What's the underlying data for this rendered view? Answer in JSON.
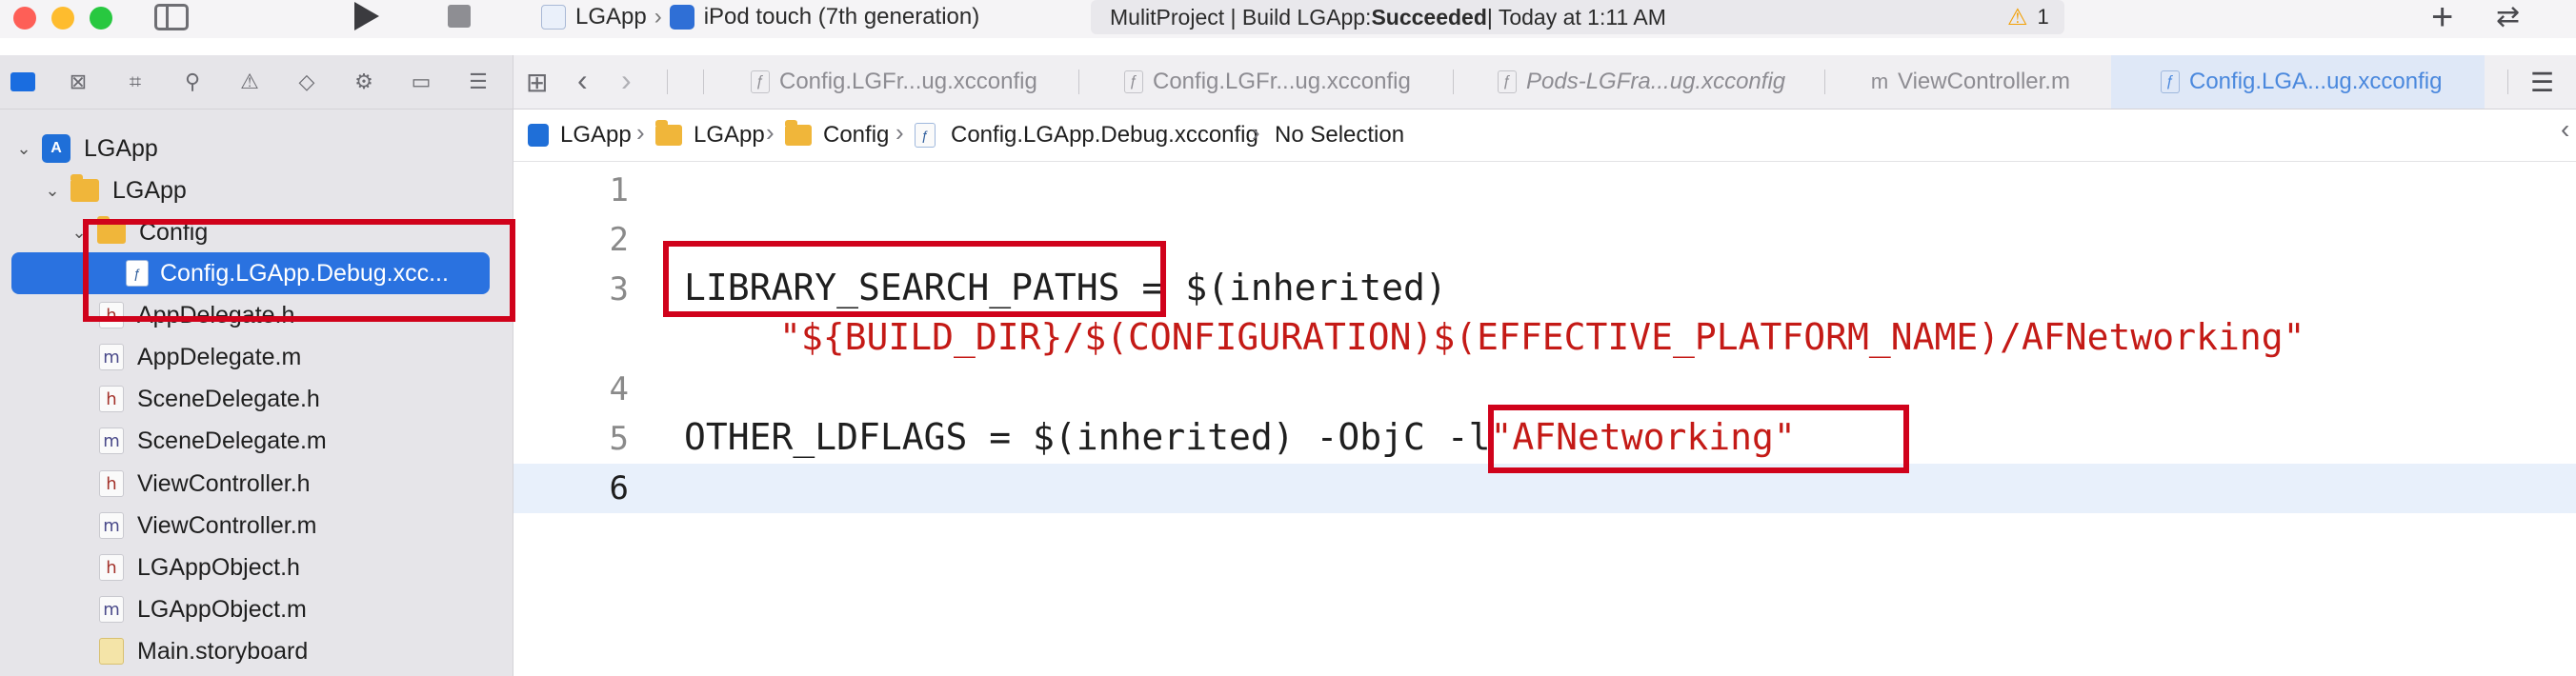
{
  "toolbar": {
    "scheme": "LGApp",
    "destination": "iPod touch (7th generation)",
    "status_project": "MulitProject | Build LGApp: ",
    "status_result": "Succeeded",
    "status_time": " | Today at 1:11 AM",
    "warning_count": "1"
  },
  "tabs": [
    {
      "label": "Config.LGFr...ug.xcconfig",
      "icon": "xcconfig-file-icon"
    },
    {
      "label": "Config.LGFr...ug.xcconfig",
      "icon": "xcconfig-file-icon"
    },
    {
      "label": "Pods-LGFra...ug.xcconfig",
      "icon": "xcconfig-file-icon"
    },
    {
      "label": "ViewController.m",
      "icon": "objc-m-file-icon"
    },
    {
      "label": "Config.LGA...ug.xcconfig",
      "icon": "xcconfig-file-icon",
      "active": true
    }
  ],
  "jumpbar": {
    "items": [
      "LGApp",
      "LGApp",
      "Config",
      "Config.LGApp.Debug.xcconfig",
      "No Selection"
    ]
  },
  "navigator": {
    "items": [
      {
        "label": "LGApp",
        "type": "project",
        "glyph": "A"
      },
      {
        "label": "LGApp",
        "type": "folder"
      },
      {
        "label": "Config",
        "type": "folder"
      },
      {
        "label": "Config.LGApp.Debug.xcc...",
        "type": "xcconfig",
        "selected": true
      },
      {
        "label": "AppDelegate.h",
        "type": "h",
        "glyph": "h"
      },
      {
        "label": "AppDelegate.m",
        "type": "m",
        "glyph": "m"
      },
      {
        "label": "SceneDelegate.h",
        "type": "h",
        "glyph": "h"
      },
      {
        "label": "SceneDelegate.m",
        "type": "m",
        "glyph": "m"
      },
      {
        "label": "ViewController.h",
        "type": "h",
        "glyph": "h"
      },
      {
        "label": "ViewController.m",
        "type": "m",
        "glyph": "m"
      },
      {
        "label": "LGAppObject.h",
        "type": "h",
        "glyph": "h"
      },
      {
        "label": "LGAppObject.m",
        "type": "m",
        "glyph": "m"
      },
      {
        "label": "Main.storyboard",
        "type": "storyboard"
      }
    ]
  },
  "editor": {
    "line_numbers": [
      "1",
      "2",
      "3",
      "4",
      "5",
      "6"
    ],
    "line3_key": "LIBRARY_SEARCH_PATHS",
    "line3_rest": " = $(inherited)",
    "line3_cont": "\"${BUILD_DIR}/$(CONFIGURATION)$(EFFECTIVE_PLATFORM_NAME)/AFNetworking\"",
    "line5_prefix": "OTHER_LDFLAGS = $(inherited) -ObjC ",
    "line5_flag": "-l",
    "line5_lib": "\"AFNetworking\""
  },
  "colors": {
    "annotation": "#d0021b",
    "selection": "#2a72e0",
    "string": "#c41a16"
  }
}
